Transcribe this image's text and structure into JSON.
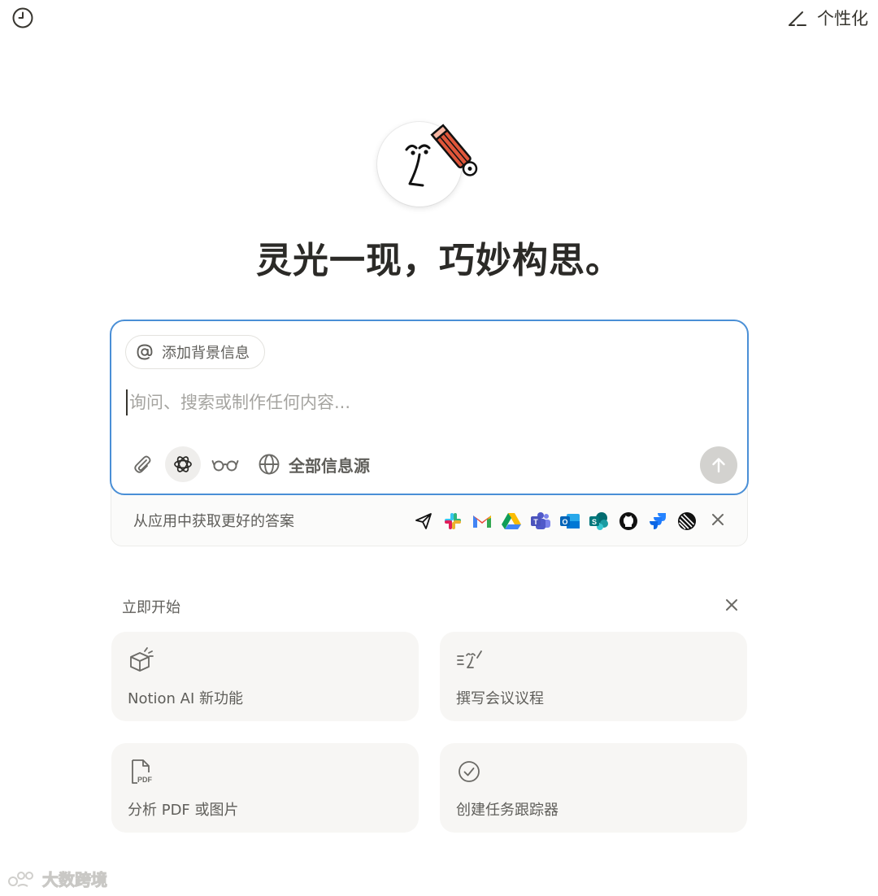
{
  "topbar": {
    "history_icon": "clock-icon",
    "personalize_label": "个性化",
    "personalize_icon": "pen-icon"
  },
  "hero": {
    "avatar_icon": "notion-ai-face-with-pencil",
    "headline": "灵光一现，巧妙构思。"
  },
  "composer": {
    "context_button_label": "添加背景信息",
    "context_icon": "at-icon",
    "placeholder": "询问、搜索或制作任何内容...",
    "value": "",
    "attach_icon": "paperclip-icon",
    "model_icon": "openai-icon",
    "reader_icon": "glasses-icon",
    "sources_icon": "globe-icon",
    "sources_label": "全部信息源",
    "send_icon": "arrow-up-icon",
    "accent_color": "#4a8fd6"
  },
  "apps": {
    "prompt_text": "从应用中获取更好的答案",
    "icons": [
      "paper-plane-icon",
      "slack-icon",
      "gmail-icon",
      "google-drive-icon",
      "teams-icon",
      "outlook-icon",
      "sharepoint-icon",
      "github-icon",
      "jira-icon",
      "linear-icon"
    ],
    "close_icon": "close-icon"
  },
  "get_started": {
    "title": "立即开始",
    "close_icon": "close-icon",
    "cards": [
      {
        "label": "Notion AI 新功能",
        "icon": "box-sparkle-icon"
      },
      {
        "label": "撰写会议议程",
        "icon": "writing-face-icon"
      },
      {
        "label": "分析 PDF 或图片",
        "icon": "pdf-icon"
      },
      {
        "label": "创建任务跟踪器",
        "icon": "check-circle-icon"
      }
    ]
  },
  "watermark": {
    "text": "大数跨境"
  }
}
